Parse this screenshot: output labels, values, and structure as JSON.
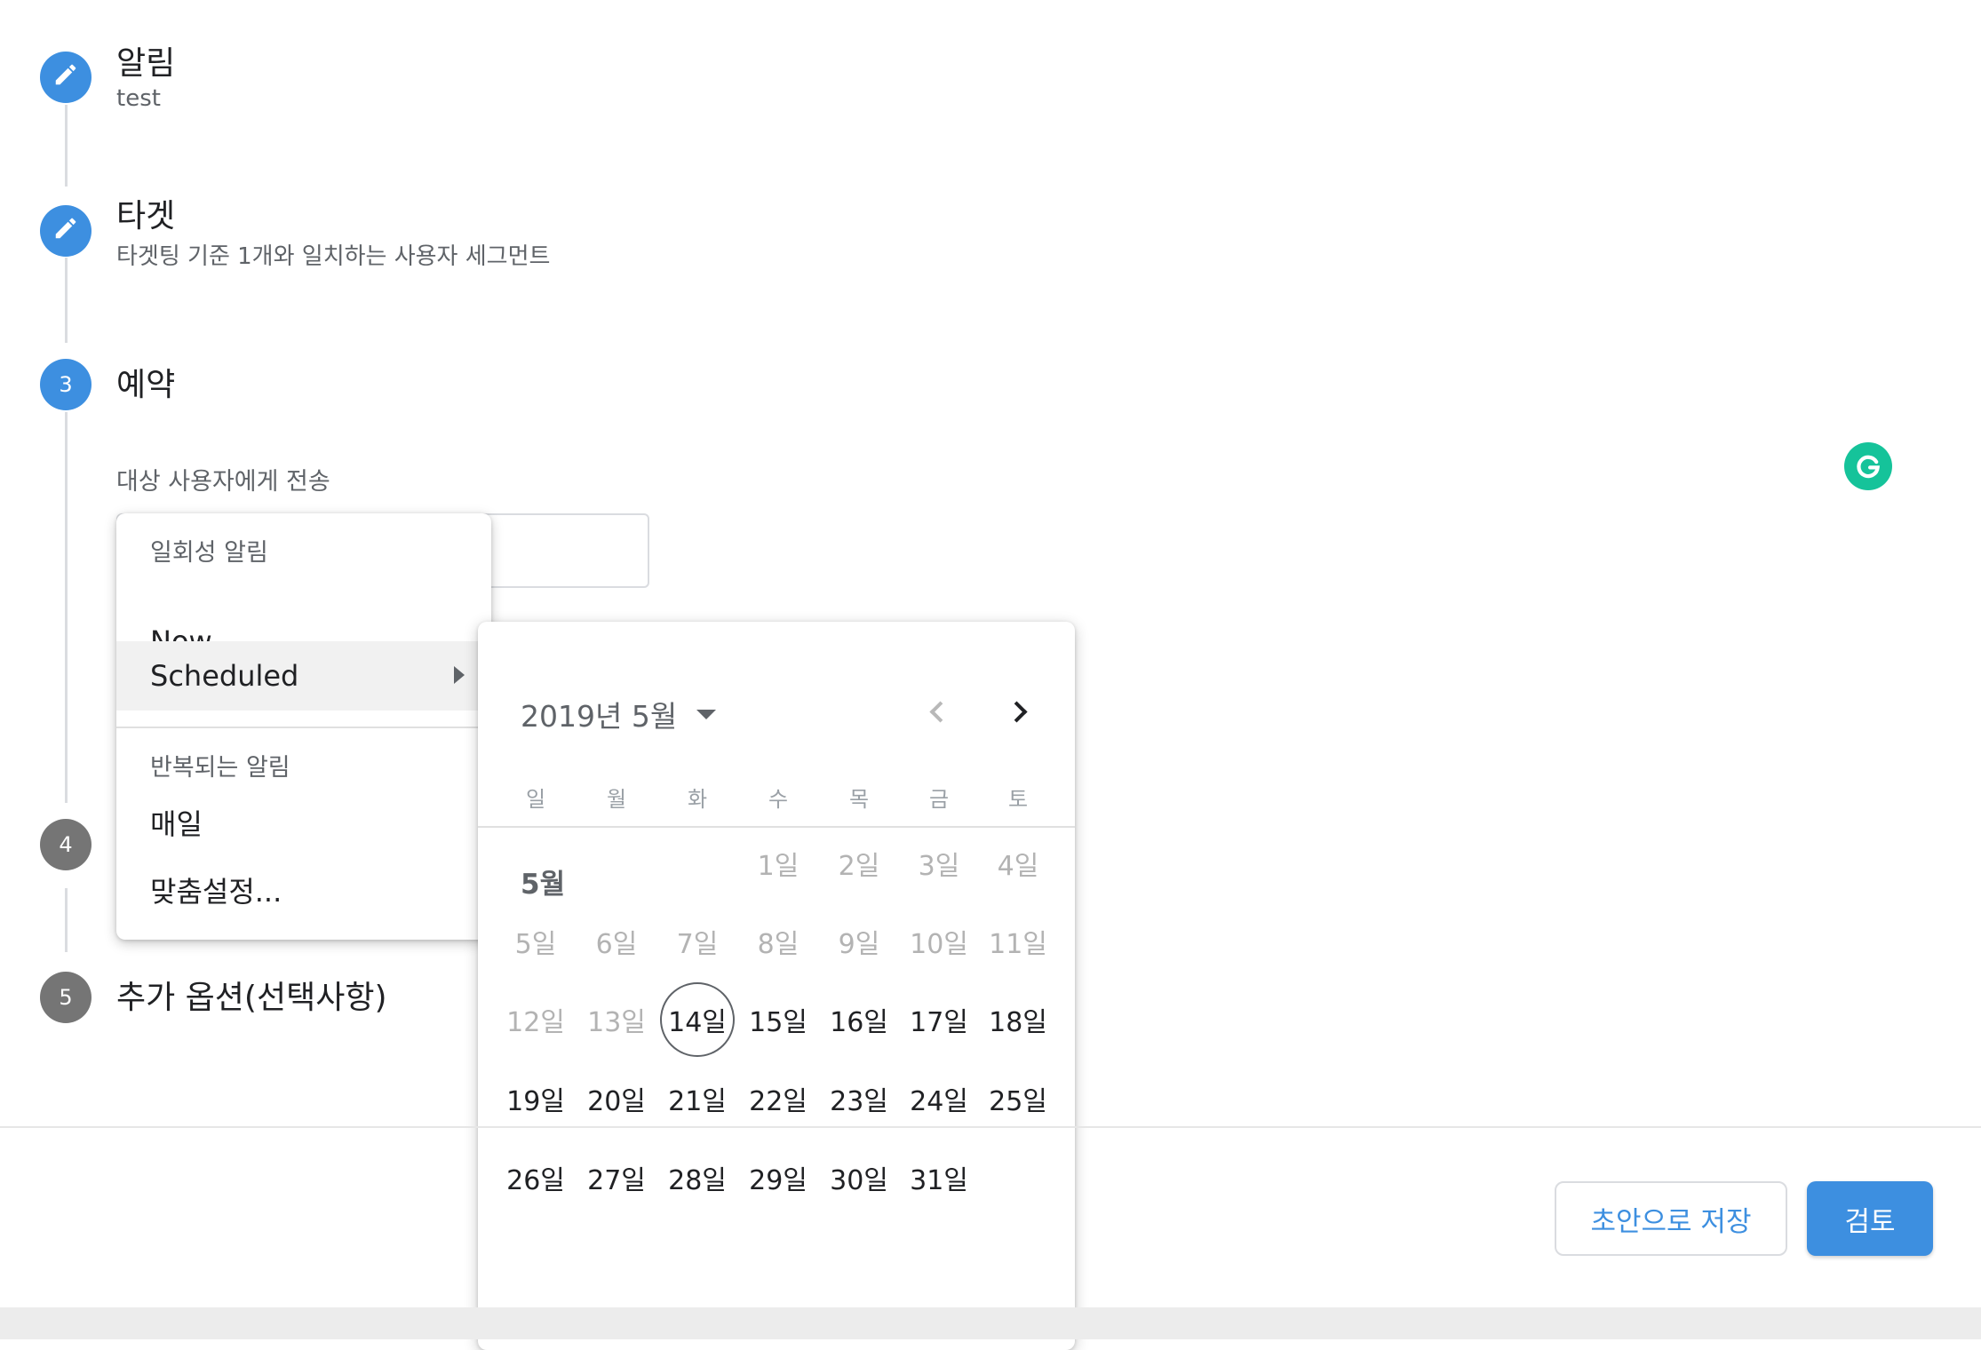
{
  "steps": [
    {
      "number": "",
      "title": "알림",
      "subtitle": "test",
      "state": "edit"
    },
    {
      "number": "",
      "title": "타겟",
      "subtitle": "타겟팅 기준 1개와 일치하는 사용자 세그먼트",
      "state": "edit"
    },
    {
      "number": "3",
      "title": "예약",
      "subtitle": "",
      "state": "active"
    },
    {
      "number": "4",
      "title": "",
      "subtitle": "",
      "state": "inactive"
    },
    {
      "number": "5",
      "title": "추가 옵션(선택사항)",
      "subtitle": "",
      "state": "inactive"
    }
  ],
  "schedule": {
    "send_label": "대상 사용자에게 전송"
  },
  "menu": {
    "one_time_header": "일회성 알림",
    "items_one_time": [
      "Now",
      "Scheduled"
    ],
    "recurring_header": "반복되는 알림",
    "items_recurring": [
      "매일",
      "맞춤설정..."
    ]
  },
  "calendar": {
    "title": "2019년 5월",
    "weekdays": [
      "일",
      "월",
      "화",
      "수",
      "목",
      "금",
      "토"
    ],
    "month_label": "5월",
    "first_weekday_index": 3,
    "days": [
      "1일",
      "2일",
      "3일",
      "4일",
      "5일",
      "6일",
      "7일",
      "8일",
      "9일",
      "10일",
      "11일",
      "12일",
      "13일",
      "14일",
      "15일",
      "16일",
      "17일",
      "18일",
      "19일",
      "20일",
      "21일",
      "22일",
      "23일",
      "24일",
      "25일",
      "26일",
      "27일",
      "28일",
      "29일",
      "30일",
      "31일"
    ],
    "selected_day": 14,
    "first_enabled_day": 14
  },
  "footer": {
    "save_draft": "초안으로 저장",
    "review": "검토"
  },
  "colors": {
    "accent": "#3d8fe0",
    "inactive_step": "#757575",
    "grammar_icon": "#15c39a"
  },
  "icons": {
    "edit": "pencil-icon",
    "grammar": "grammarly-icon",
    "prev": "chevron-left-icon",
    "next": "chevron-right-icon",
    "dropdown": "caret-down-icon",
    "submenu": "caret-right-icon"
  }
}
